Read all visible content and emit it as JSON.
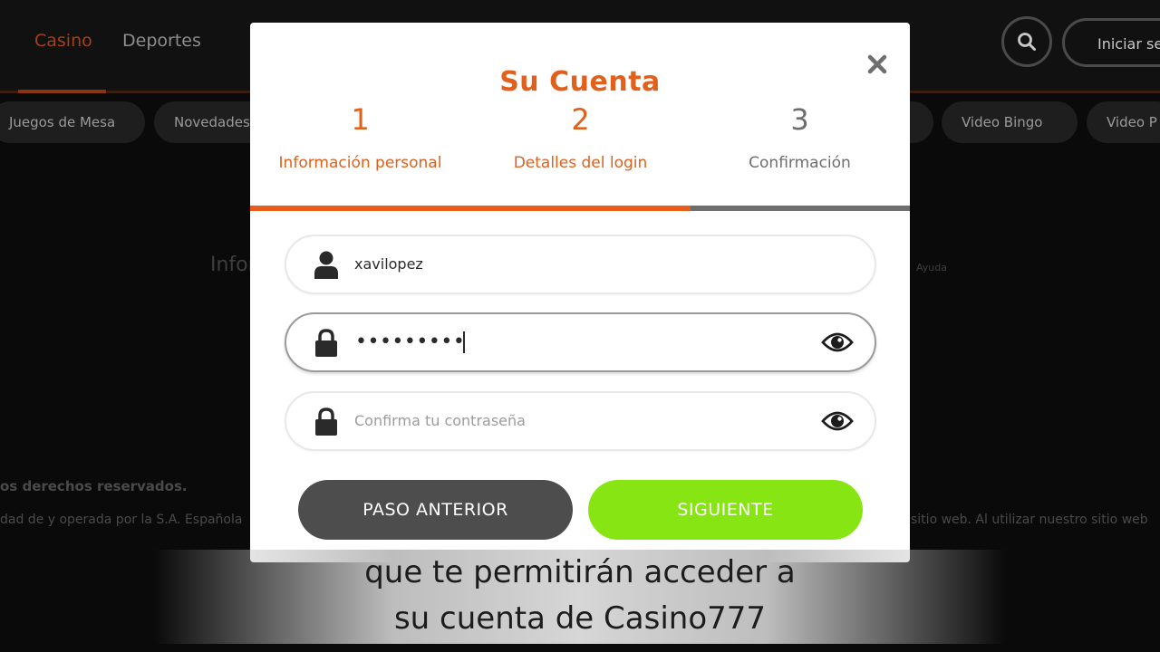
{
  "background": {
    "nav": {
      "casino_label": "Casino",
      "deportes_label": "Deportes",
      "login_label": "Iniciar sesión"
    },
    "categories": [
      "Juegos de Mesa",
      "Novedades",
      "Video Bingo",
      "Video P"
    ],
    "info_text": "Infor",
    "ayuda_text": "Ayuda",
    "rights_text": "os derechos reservados.",
    "owned_text": "dad de y operada por la S.A. Española",
    "website_text": "sitio web. Al utilizar nuestro sitio web"
  },
  "modal": {
    "title": "Su Cuenta",
    "steps": [
      {
        "number": "1",
        "label": "Información personal",
        "state": "done"
      },
      {
        "number": "2",
        "label": "Detalles del login",
        "state": "current"
      },
      {
        "number": "3",
        "label": "Confirmación",
        "state": "pending"
      }
    ],
    "progress_fraction": 0.667,
    "username": {
      "value": "xavilopez",
      "icon": "user-icon"
    },
    "password": {
      "value": "•••••••••",
      "icon": "lock-icon"
    },
    "confirm_password": {
      "placeholder": "Confirma tu contraseña",
      "icon": "lock-icon"
    },
    "prev_button": "PASO ANTERIOR",
    "next_button": "SIGUIENTE"
  },
  "caption": {
    "line1": "que te permitirán acceder a",
    "line2": "su cuenta de Casino777"
  },
  "colors": {
    "accent": "#e0601c",
    "next_button": "#86e513",
    "prev_button": "#4d4d4d"
  }
}
